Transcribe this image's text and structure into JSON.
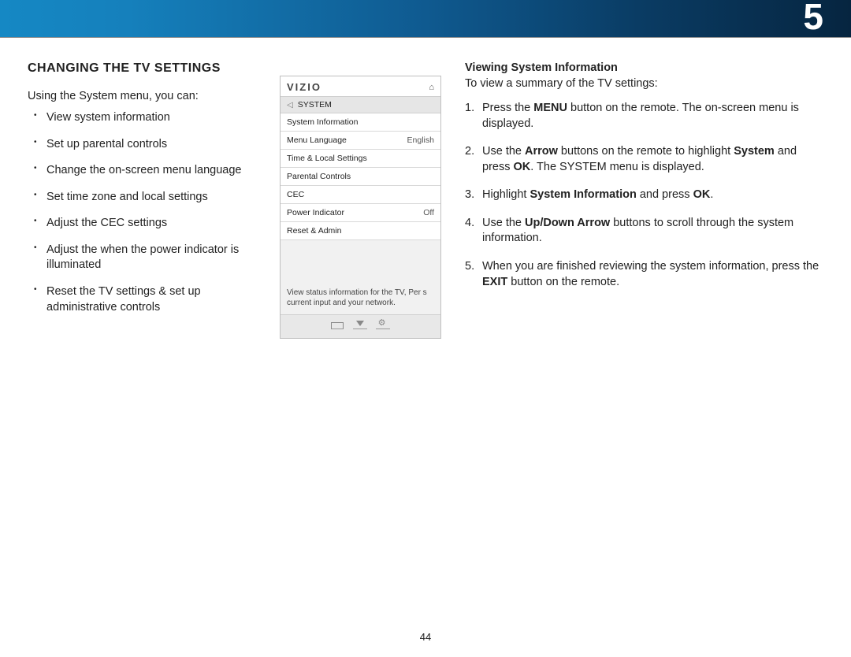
{
  "chapter_number": "5",
  "page_number": "44",
  "left": {
    "heading": "CHANGING THE TV SETTINGS",
    "intro": "Using the System menu, you can:",
    "bullets": [
      "View system information",
      "Set up parental controls",
      "Change the on-screen menu language",
      "Set time zone and local settings",
      "Adjust the CEC settings",
      "Adjust the when the power indicator is illuminated",
      "Reset the TV settings & set up administrative controls"
    ]
  },
  "panel": {
    "logo": "VIZIO",
    "crumb": "SYSTEM",
    "rows": [
      {
        "label": "System Information",
        "value": ""
      },
      {
        "label": "Menu Language",
        "value": "English"
      },
      {
        "label": "Time & Local Settings",
        "value": ""
      },
      {
        "label": "Parental Controls",
        "value": ""
      },
      {
        "label": "CEC",
        "value": ""
      },
      {
        "label": "Power Indicator",
        "value": "Off"
      },
      {
        "label": "Reset & Admin",
        "value": ""
      }
    ],
    "help_text": "View status information for the TV, Per s current input and your network."
  },
  "right": {
    "subhead": "Viewing System Information",
    "subintro": "To view a summary of the TV settings:",
    "steps": [
      [
        {
          "t": "Press the "
        },
        {
          "b": "MENU"
        },
        {
          "t": " button on the remote. The on-screen menu is displayed."
        }
      ],
      [
        {
          "t": "Use the "
        },
        {
          "b": "Arrow"
        },
        {
          "t": " buttons on the remote to highlight "
        },
        {
          "b": "System"
        },
        {
          "t": " and press "
        },
        {
          "b": "OK"
        },
        {
          "t": ". The SYSTEM menu is displayed."
        }
      ],
      [
        {
          "t": "Highlight "
        },
        {
          "b": "System Information"
        },
        {
          "t": " and press "
        },
        {
          "b": "OK"
        },
        {
          "t": "."
        }
      ],
      [
        {
          "t": "Use the "
        },
        {
          "b": "Up/Down Arrow"
        },
        {
          "t": " buttons to scroll through the system information."
        }
      ],
      [
        {
          "t": "When you are finished reviewing the system information, press the "
        },
        {
          "b": "EXIT"
        },
        {
          "t": " button on the remote."
        }
      ]
    ]
  }
}
